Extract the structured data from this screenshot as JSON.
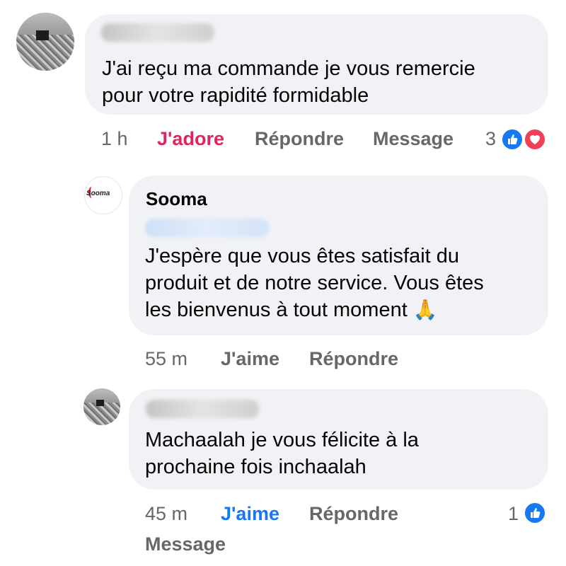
{
  "comments": [
    {
      "text_lines": [
        "J'ai reçu  ma commande je vous remercie",
        "pour votre rapidité formidable"
      ],
      "actions": {
        "time": "1 h",
        "react": "J'adore",
        "reply": "Répondre",
        "message": "Message"
      },
      "reaction_count": "3",
      "reaction_icons": [
        "like-icon",
        "heart-icon"
      ]
    },
    {
      "author": "Sooma",
      "text_lines": [
        "J'espère que vous êtes satisfait du",
        "produit et de notre service. Vous êtes",
        "les bienvenus à tout moment"
      ],
      "emoji": "🙏",
      "actions": {
        "time": "55 m",
        "react": "J'aime",
        "reply": "Répondre"
      }
    },
    {
      "text_lines": [
        "Machaalah je vous félicite à la",
        "prochaine fois inchaalah"
      ],
      "actions": {
        "time": "45 m",
        "react": "J'aime",
        "reply": "Répondre",
        "message": "Message"
      },
      "reaction_count": "1",
      "reaction_icons": [
        "like-icon"
      ]
    }
  ],
  "logo_text": "Sooma",
  "colors": {
    "bubble": "#f0f2f5",
    "meta": "#65676b",
    "love": "#e0245e",
    "like": "#1877f2",
    "heart": "#f33e58"
  }
}
